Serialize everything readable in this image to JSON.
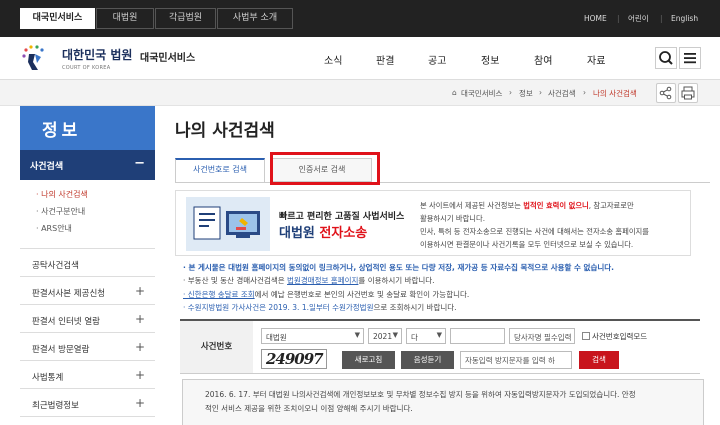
{
  "topbar": {
    "tabs": [
      "대국민서비스",
      "대법원",
      "각급법원",
      "사법부 소개"
    ],
    "links": [
      "HOME",
      "어린이",
      "English"
    ]
  },
  "header": {
    "logo_main": "대한민국 법원",
    "logo_sub": "COURT OF KOREA",
    "service": "대국민서비스",
    "gnb": [
      "소식",
      "판결",
      "공고",
      "정보",
      "참여",
      "자료"
    ]
  },
  "breadcrumb": [
    "대국민서비스",
    "정보",
    "사건검색",
    "나의 사건검색"
  ],
  "sidebar": {
    "title": "정보",
    "category": "사건검색",
    "category_mark": "−",
    "subitems": [
      "· 나의 사건검색",
      "· 사건구분안내",
      "· ARS안내"
    ],
    "items": [
      {
        "label": "공탁사건검색",
        "plus": ""
      },
      {
        "label": "판결서사본 제공신청",
        "plus": "+"
      },
      {
        "label": "판결서 인터넷 열람",
        "plus": "+"
      },
      {
        "label": "판결서 방문열람",
        "plus": "+"
      },
      {
        "label": "사법통계",
        "plus": "+"
      },
      {
        "label": "최근법령정보",
        "plus": "+"
      }
    ]
  },
  "main": {
    "title": "나의 사건검색",
    "tab1": "사건번호로 검색",
    "tab2": "인증서로 검색",
    "banner": {
      "line1": "빠르고 편리한 고품질 사법서비스",
      "line2a": "대법원 ",
      "line2b": "전자소송",
      "desc1": "본 사이트에서 제공된 사건정보는 ",
      "desc1_red": "법적인 효력이 없으니",
      "desc1_end": ", 참고자료로만",
      "desc2": "활용하시기 바랍니다.",
      "desc3": "민사, 특허 등 전자소송으로 진행되는 사건에 대해서는 전자소송 홈페이지를",
      "desc4": "이용하시면 판결문이나 사건기록을 모두 인터넷으로 보실 수 있습니다."
    },
    "notes": {
      "n1": "· 본 게시물은 대법원 홈페이지의 동의없이 링크하거나, 상업적인 용도 또는 다량 저장, 재가공 등 자료수집 목적으로 사용할 수 없습니다.",
      "n2a": "· 부동산 및 동산 경매사건검색은 ",
      "n2_link": "법원경매정보 홈페이지",
      "n2b": "를 이용하시기 바랍니다.",
      "n3_link": "· 신한은행 송달료 조회",
      "n3b": "에서 예납 은행번호로 본인의 사건번호 및 송달료 확인이 가능합니다.",
      "n4": "· 수원지방법원 가사사건은 2019. 3. 1.일부터 수원가정법원",
      "n4b": "으로 조회하시기 바랍니다."
    },
    "form": {
      "label": "사건번호",
      "court": "대법원",
      "year": "2021",
      "type": "다",
      "party_placeholder": "당사자명 필수입력",
      "checkbox_label": "사건번호입력모드",
      "captcha": "249097",
      "refresh_btn": "새로고침",
      "audio_btn": "음성듣기",
      "captcha_placeholder": "자동입력 방지문자를 입력 하",
      "search_btn": "검색"
    },
    "info": {
      "l1": "2016. 6. 17. 부터 대법원 나의사건검색에 개인정보보호 및 무차별 정보수집 방지 등을 위하여 자동입력방지문자가 도입되었습니다. 안정",
      "l2": "적인 서비스 제공을 위한 조치이오니 이점 양해해 주시기 바랍니다."
    }
  },
  "colors": {
    "topbar": "#222222",
    "sidebar_title": "#3a76c9",
    "sidebar_cat": "#1f3f78",
    "accent_red": "#e0121a"
  }
}
